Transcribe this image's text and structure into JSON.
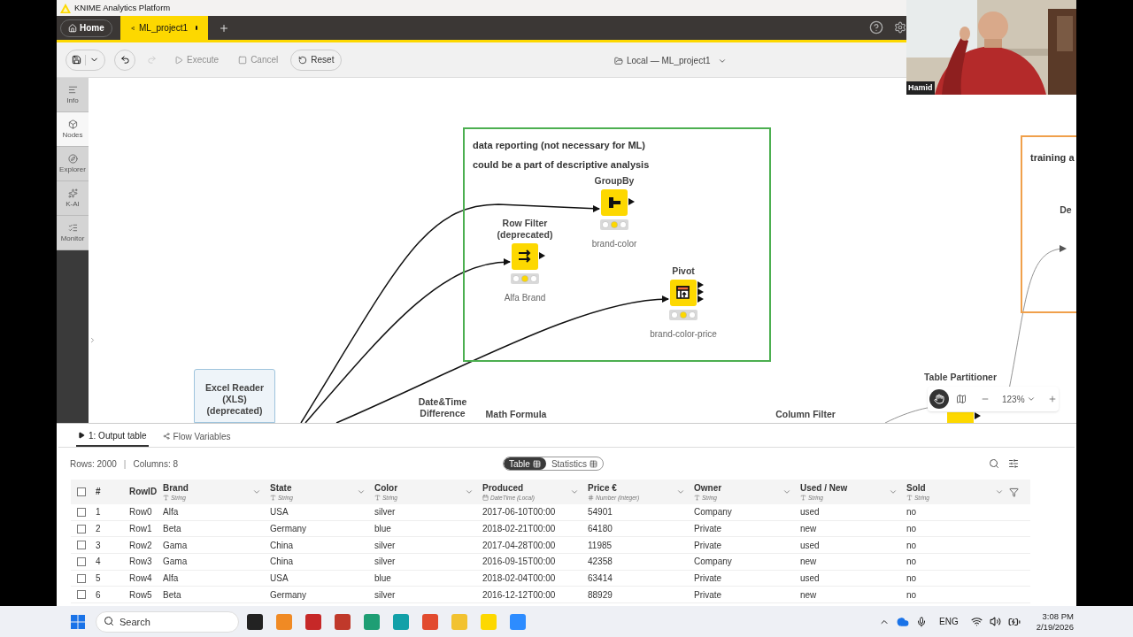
{
  "window": {
    "title": "KNIME Analytics Platform"
  },
  "tabs": [
    {
      "kind": "home",
      "label": "Home",
      "selected": false
    },
    {
      "kind": "workflow",
      "label": "ML_project1",
      "selected": true,
      "unsaved": true
    }
  ],
  "toolbar": {
    "actions": [
      {
        "kind": "execute",
        "label": "Execute",
        "disabled": true
      },
      {
        "kind": "cancel",
        "label": "Cancel",
        "disabled": true
      },
      {
        "kind": "reset",
        "label": "Reset",
        "disabled": false
      }
    ],
    "redo_disabled": true,
    "location": "Local — ML_project1"
  },
  "sidebar": [
    {
      "kind": "info",
      "label": "Info",
      "selected": false
    },
    {
      "kind": "nodes",
      "label": "Nodes",
      "selected": true
    },
    {
      "kind": "explorer",
      "label": "Explorer",
      "selected": false
    },
    {
      "kind": "kai",
      "label": "K-AI",
      "selected": false
    },
    {
      "kind": "monitor",
      "label": "Monitor",
      "selected": false
    }
  ],
  "canvas": {
    "annotations": [
      {
        "text": [
          "data reporting (not necessary for ML)",
          "could be a part of descriptive analysis"
        ],
        "color": "#4caf50"
      },
      {
        "text": [
          "training a"
        ],
        "color": "#f0a04b"
      }
    ],
    "nodes": [
      {
        "kind": "groupby",
        "title": "GroupBy",
        "label": "brand-color",
        "configured": true
      },
      {
        "kind": "rowfilter",
        "title": "Row Filter\n(deprecated)",
        "label": "Alfa Brand",
        "configured": true
      },
      {
        "kind": "pivot",
        "title": "Pivot",
        "label": "brand-color-price",
        "configured": true
      }
    ],
    "node_titles": [
      {
        "kind": "selected",
        "title": "Excel Reader\n(XLS)\n(deprecated)"
      },
      {
        "kind": "plain",
        "title": "Date&Time\nDifference"
      },
      {
        "kind": "plain",
        "title": "Math Formula"
      },
      {
        "kind": "plain",
        "title": "Column Filter"
      },
      {
        "kind": "plain",
        "title": "Table Partitioner"
      },
      {
        "kind": "plain",
        "title": "De"
      }
    ],
    "zoom": "123%"
  },
  "output": {
    "tabs": [
      {
        "label": "1: Output table",
        "selected": true
      },
      {
        "label": "Flow Variables",
        "selected": false
      }
    ],
    "rows_info": "Rows: 2000",
    "separator": "|",
    "cols_info": "Columns: 8",
    "views": [
      {
        "label": "Table",
        "selected": true
      },
      {
        "label": "Statistics",
        "selected": false
      }
    ],
    "all_checked": false,
    "columns": [
      {
        "kind": "index",
        "name": "#"
      },
      {
        "kind": "index",
        "name": "RowID"
      },
      {
        "kind": "string",
        "name": "Brand",
        "type": "String"
      },
      {
        "kind": "string",
        "name": "State",
        "type": "String"
      },
      {
        "kind": "string",
        "name": "Color",
        "type": "String"
      },
      {
        "kind": "datetime",
        "name": "Produced",
        "type": "DateTime (Local)"
      },
      {
        "kind": "number",
        "name": "Price €",
        "type": "Number (integer)"
      },
      {
        "kind": "string",
        "name": "Owner",
        "type": "String"
      },
      {
        "kind": "string",
        "name": "Used / New",
        "type": "String"
      },
      {
        "kind": "string",
        "name": "Sold",
        "type": "String"
      }
    ],
    "rows": [
      {
        "checked": false,
        "cells": [
          "1",
          "Row0",
          "Alfa",
          "USA",
          "silver",
          "2017-06-10T00:00",
          "54901",
          "Company",
          "used",
          "no"
        ]
      },
      {
        "checked": false,
        "cells": [
          "2",
          "Row1",
          "Beta",
          "Germany",
          "blue",
          "2018-02-21T00:00",
          "64180",
          "Private",
          "new",
          "no"
        ]
      },
      {
        "checked": false,
        "cells": [
          "3",
          "Row2",
          "Gama",
          "China",
          "silver",
          "2017-04-28T00:00",
          "11985",
          "Private",
          "used",
          "no"
        ]
      },
      {
        "checked": false,
        "cells": [
          "4",
          "Row3",
          "Gama",
          "China",
          "silver",
          "2016-09-15T00:00",
          "42358",
          "Company",
          "new",
          "no"
        ]
      },
      {
        "checked": false,
        "cells": [
          "5",
          "Row4",
          "Alfa",
          "USA",
          "blue",
          "2018-02-04T00:00",
          "63414",
          "Private",
          "used",
          "no"
        ]
      },
      {
        "checked": false,
        "cells": [
          "6",
          "Row5",
          "Beta",
          "Germany",
          "silver",
          "2016-12-12T00:00",
          "88929",
          "Private",
          "new",
          "no"
        ]
      }
    ]
  },
  "taskbar": {
    "search_placeholder": "Search",
    "language": "ENG",
    "time": "3:08 PM",
    "date": "2/19/2026"
  },
  "video": {
    "name": "Hamid"
  }
}
